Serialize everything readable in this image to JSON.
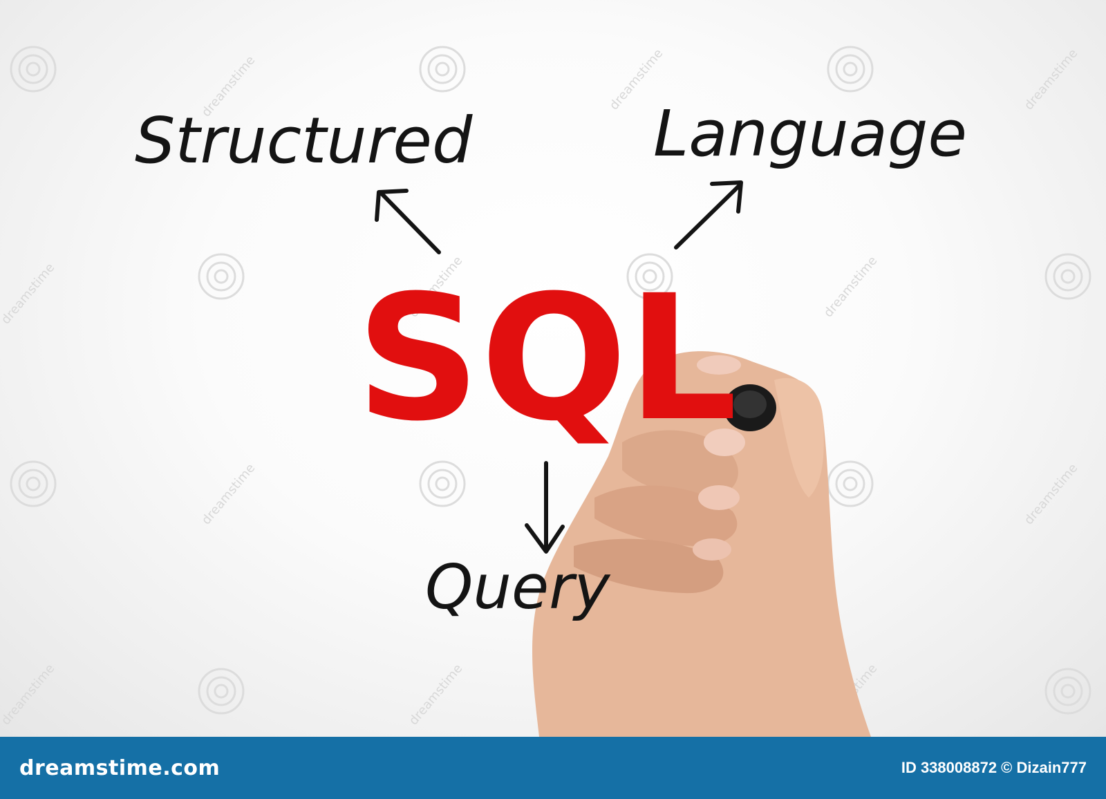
{
  "diagram": {
    "center_word": "SQL",
    "top_left_word": "Structured",
    "top_right_word": "Language",
    "bottom_word": "Query"
  },
  "colors": {
    "accent_red": "#e10f0f",
    "ink_black": "#141414",
    "footer_blue": "#1570a6"
  },
  "watermark": {
    "text": "dreamstime"
  },
  "footer": {
    "brand": "dreamstime.com",
    "image_id": "ID 338008872 © Dizain777"
  }
}
